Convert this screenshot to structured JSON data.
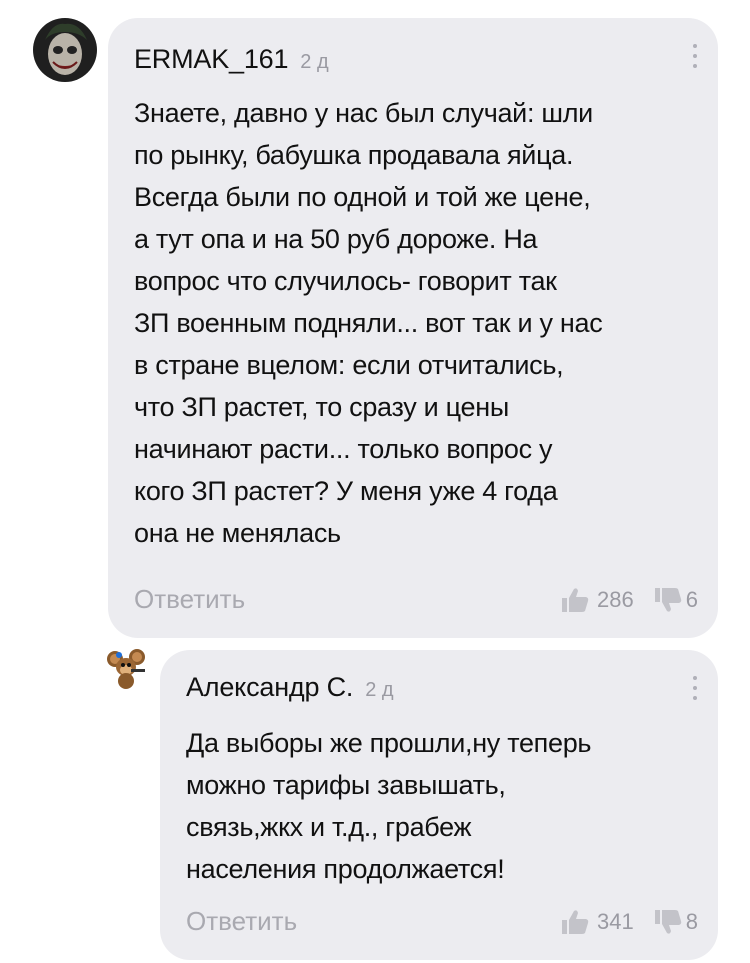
{
  "comments": [
    {
      "author": "ERMAK_161",
      "time": "2 д",
      "text_lines": [
        "Знаете, давно у нас был случай: шли",
        "по рынку, бабушка продавала яйца.",
        "Всегда были по одной и той же цене,",
        "а тут опа и на 50 руб дороже. На",
        "вопрос что случилось- говорит так",
        "ЗП военным подняли... вот так и у нас",
        "в стране вцелом: если отчитались,",
        "что ЗП растет, то сразу и цены",
        "начинают расти... только вопрос у",
        "кого ЗП растет? У меня уже 4 года",
        "она не менялась"
      ],
      "reply_label": "Ответить",
      "likes": "286",
      "dislikes": "6",
      "avatar_icon": "joker-avatar"
    },
    {
      "author": "Александр С.",
      "time": "2 д",
      "text_lines": [
        "Да выборы же прошли,ну теперь",
        "можно тарифы завышать,",
        "связь,жкх и т.д., грабеж",
        "населения продолжается!"
      ],
      "reply_label": "Ответить",
      "likes": "341",
      "dislikes": "8",
      "avatar_icon": "cheburashka-avatar"
    }
  ],
  "colors": {
    "bubble": "#ececf0",
    "muted": "#9a9aa2",
    "reply": "#a9a9b0",
    "vote_icon": "#c3c3c9",
    "text": "#111111"
  }
}
